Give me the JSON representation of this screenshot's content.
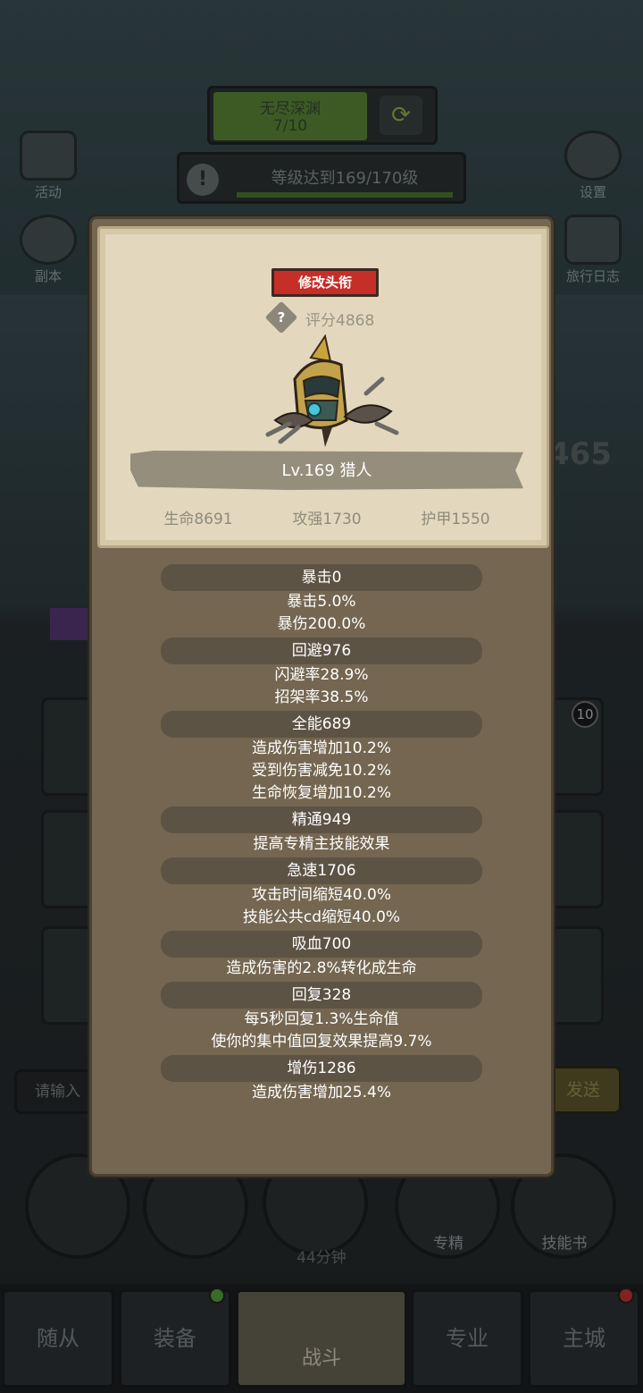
{
  "background": {
    "stage": {
      "title": "无尽深渊",
      "progress": "7/10",
      "refresh_icon": "refresh-icon"
    },
    "quest": {
      "text": "等级达到169/170级",
      "icon": "exclamation-icon"
    },
    "left_buttons": [
      {
        "label": "活动",
        "icon": "calendar-icon"
      },
      {
        "label": "副本",
        "icon": "portal-icon"
      }
    ],
    "right_buttons": [
      {
        "label": "设置",
        "icon": "gear-icon"
      },
      {
        "label": "旅行日志",
        "icon": "journal-icon"
      }
    ],
    "kill_count": "465",
    "slot_badge": "10",
    "chat": {
      "placeholder": "请输入",
      "send_label": "发送"
    },
    "actions": [
      {
        "label": "",
        "icon": "potion-icon"
      },
      {
        "label": "",
        "icon": "bread-icon"
      },
      {
        "label": "",
        "icon": "chest-icon"
      },
      {
        "label": "专精",
        "icon": "spec-icon"
      },
      {
        "label": "技能书",
        "icon": "skillbook-icon"
      }
    ],
    "timer": "44分钟",
    "nav": [
      {
        "label": "随从"
      },
      {
        "label": "装备"
      },
      {
        "label": "战斗"
      },
      {
        "label": "专业"
      },
      {
        "label": "主城"
      }
    ]
  },
  "character": {
    "rename_label": "修改头衔",
    "score": "评分4868",
    "name": "Lv.169 猎人",
    "hp": "生命8691",
    "attack": "攻强1730",
    "armor": "护甲1550"
  },
  "attributes": [
    {
      "header": "暴击0",
      "lines": [
        "暴击5.0%",
        "暴伤200.0%"
      ]
    },
    {
      "header": "回避976",
      "lines": [
        "闪避率28.9%",
        "招架率38.5%"
      ]
    },
    {
      "header": "全能689",
      "lines": [
        "造成伤害增加10.2%",
        "受到伤害减免10.2%",
        "生命恢复增加10.2%"
      ]
    },
    {
      "header": "精通949",
      "lines": [
        "提高专精主技能效果"
      ]
    },
    {
      "header": "急速1706",
      "lines": [
        "攻击时间缩短40.0%",
        "技能公共cd缩短40.0%"
      ]
    },
    {
      "header": "吸血700",
      "lines": [
        "造成伤害的2.8%转化成生命"
      ]
    },
    {
      "header": "回复328",
      "lines": [
        "每5秒回复1.3%生命值",
        "使你的集中值回复效果提高9.7%"
      ]
    },
    {
      "header": "增伤1286",
      "lines": [
        "造成伤害增加25.4%"
      ]
    }
  ],
  "colors": {
    "panel": "#746650",
    "parchment": "#e3d8bd",
    "rename_button": "#c52f27",
    "stage_fill": "#5e8a3a"
  }
}
